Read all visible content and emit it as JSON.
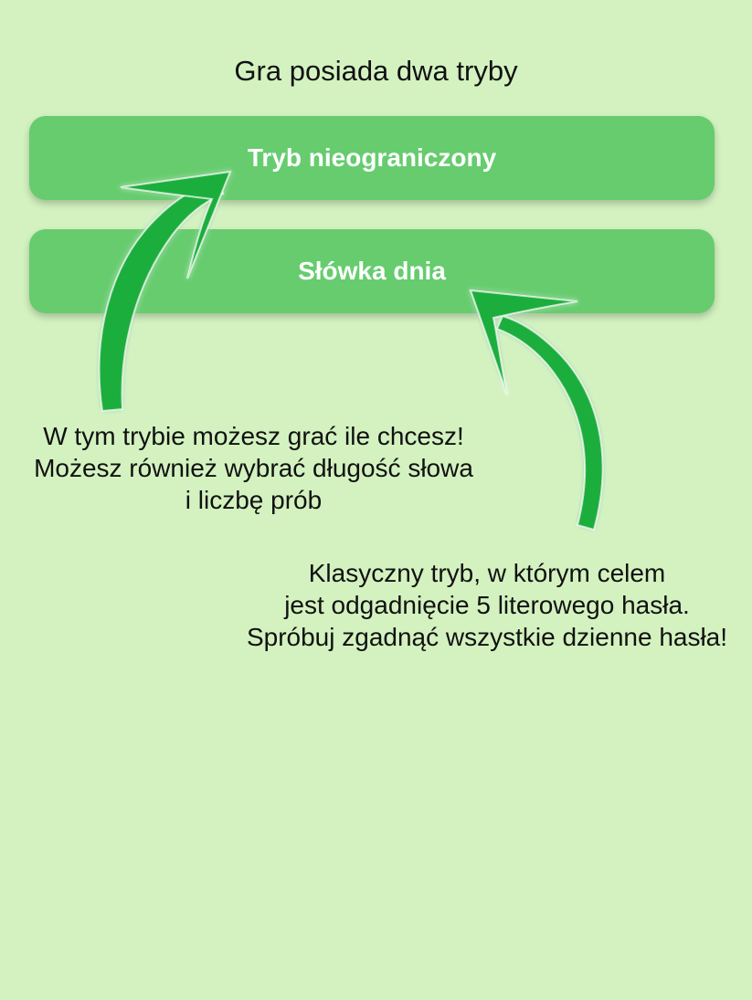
{
  "header": {
    "title": "Gra posiada dwa tryby"
  },
  "modes": {
    "unlimited_label": "Tryb nieograniczony",
    "daily_label": "Słówka dnia"
  },
  "descriptions": {
    "unlimited_lines": [
      "W tym trybie możesz grać ile chcesz!",
      "Możesz również wybrać długość słowa",
      "i liczbę prób"
    ],
    "daily_lines": [
      "Klasyczny tryb, w którym celem",
      "jest odgadnięcie 5 literowego hasła.",
      "Spróbuj zgadnąć wszystkie dzienne hasła!"
    ]
  },
  "colors": {
    "background": "#d3f2c0",
    "button": "#66cc6e",
    "arrow": "#1fae3c"
  },
  "icons": {
    "arrow_left": "curved-arrow-up-right-icon",
    "arrow_right": "curved-arrow-up-left-icon"
  }
}
